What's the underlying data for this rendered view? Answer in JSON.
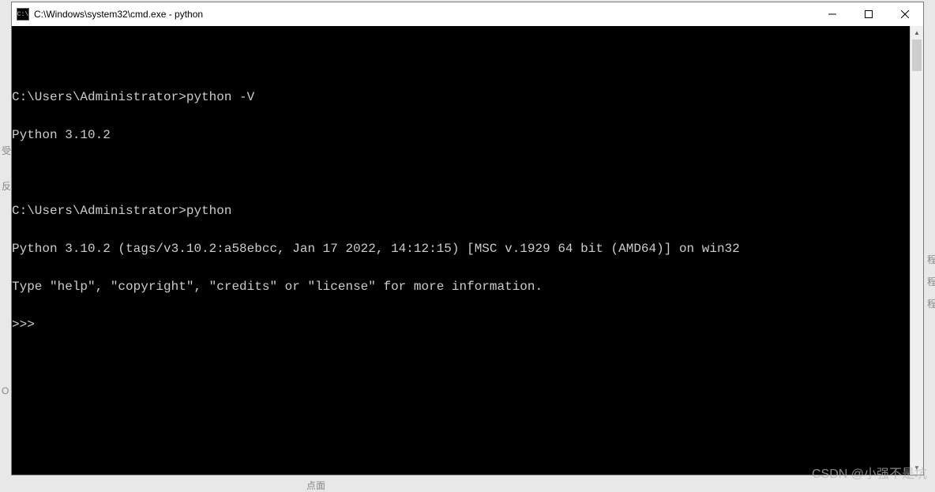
{
  "window": {
    "title": "C:\\Windows\\system32\\cmd.exe - python",
    "icon_label": "C:\\"
  },
  "terminal": {
    "lines": [
      "",
      "C:\\Users\\Administrator>python -V",
      "Python 3.10.2",
      "",
      "C:\\Users\\Administrator>python",
      "Python 3.10.2 (tags/v3.10.2:a58ebcc, Jan 17 2022, 14:12:15) [MSC v.1929 64 bit (AMD64)] on win32",
      "Type \"help\", \"copyright\", \"credits\" or \"license\" for more information.",
      ">>>"
    ]
  },
  "watermark": "CSDN @小强不是坑",
  "bg_hints": {
    "a": "受",
    "b": "反",
    "c": "O",
    "d": "程",
    "e": "程",
    "f": "程",
    "g": "点面"
  }
}
